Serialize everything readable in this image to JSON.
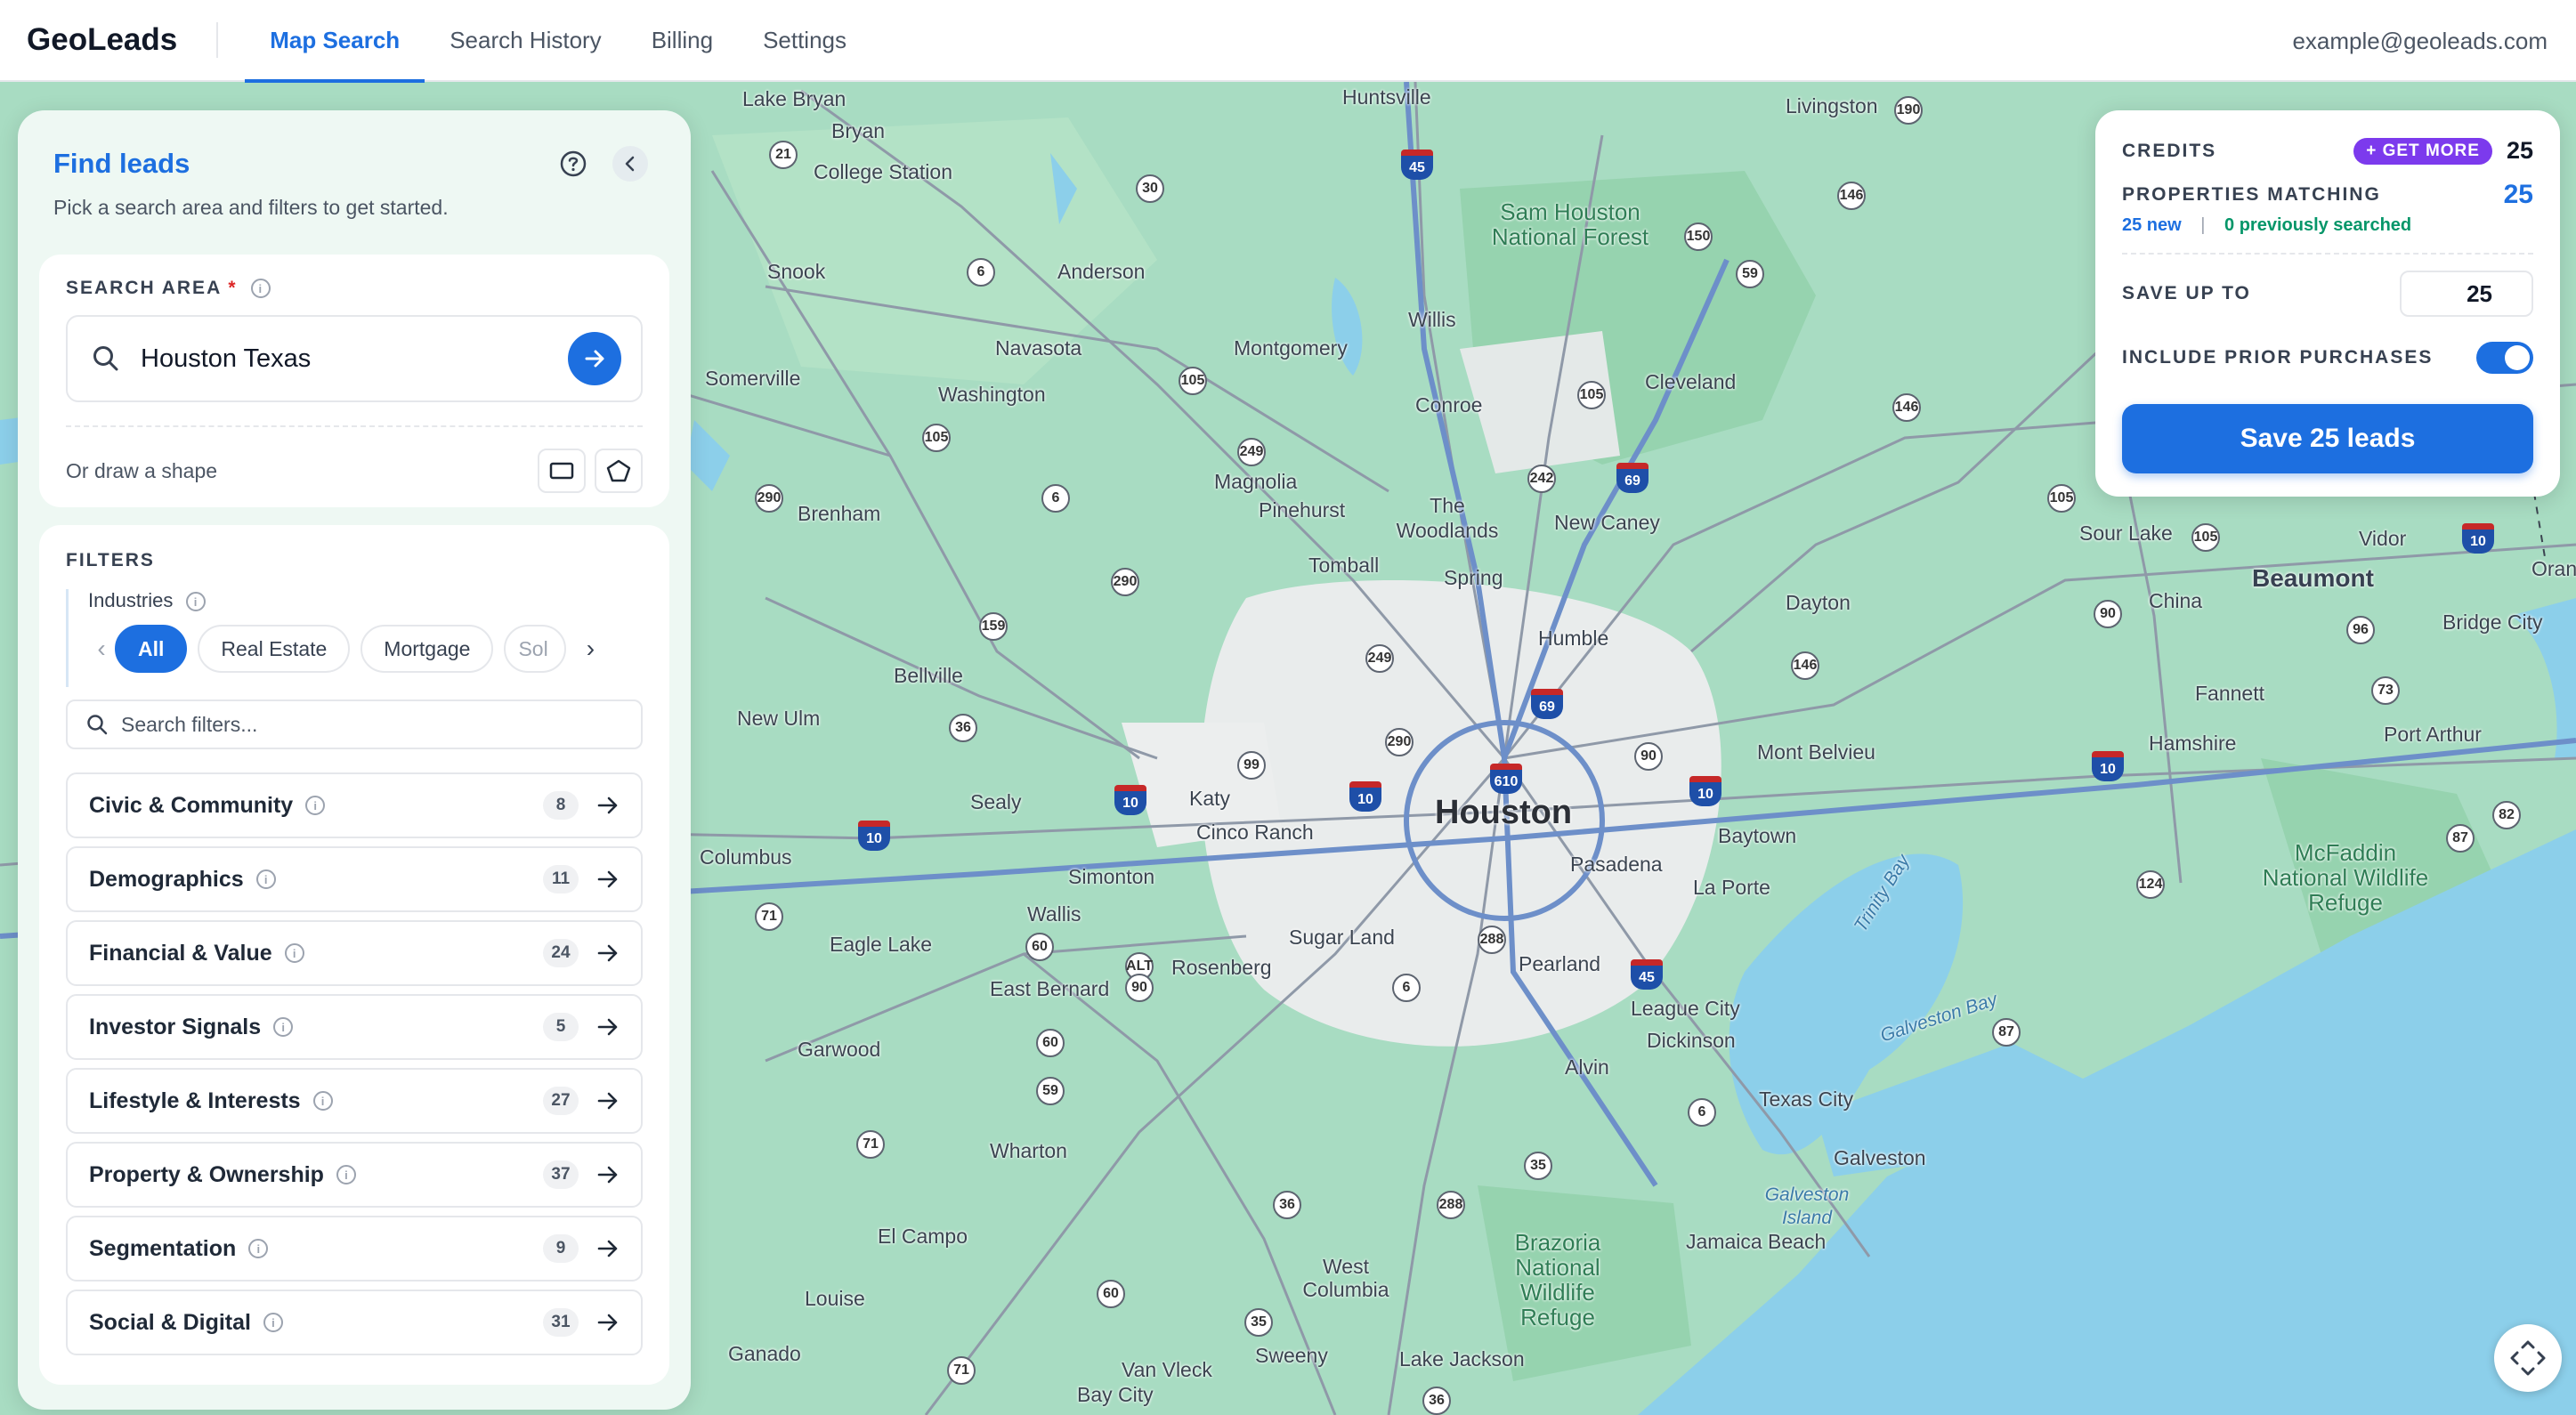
{
  "app": {
    "brand": "GeoLeads",
    "nav": [
      {
        "label": "Map Search",
        "active": true
      },
      {
        "label": "Search History",
        "active": false
      },
      {
        "label": "Billing",
        "active": false
      },
      {
        "label": "Settings",
        "active": false
      }
    ],
    "user_email": "example@geoleads.com"
  },
  "panel": {
    "title": "Find leads",
    "subtitle": "Pick a search area and filters to get started.",
    "search_area": {
      "label": "SEARCH AREA",
      "required_mark": "*",
      "value": "Houston Texas",
      "draw_label": "Or draw a shape"
    },
    "filters": {
      "label": "FILTERS",
      "industries_label": "Industries",
      "chips": [
        "All",
        "Real Estate",
        "Mortgage",
        "Sol"
      ],
      "search_placeholder": "Search filters...",
      "categories": [
        {
          "name": "Civic & Community",
          "count": "8"
        },
        {
          "name": "Demographics",
          "count": "11"
        },
        {
          "name": "Financial & Value",
          "count": "24"
        },
        {
          "name": "Investor Signals",
          "count": "5"
        },
        {
          "name": "Lifestyle & Interests",
          "count": "27"
        },
        {
          "name": "Property & Ownership",
          "count": "37"
        },
        {
          "name": "Segmentation",
          "count": "9"
        },
        {
          "name": "Social & Digital",
          "count": "31"
        }
      ]
    }
  },
  "credits": {
    "credits_label": "CREDITS",
    "get_more_label": "+ GET MORE",
    "credits_value": "25",
    "matching_label": "PROPERTIES MATCHING",
    "matching_value": "25",
    "new_text": "25 new",
    "sep": "|",
    "prev_text": "0 previously searched",
    "save_up_to_label": "SAVE UP TO",
    "save_up_to_value": "25",
    "include_prior_label": "INCLUDE PRIOR PURCHASES",
    "include_prior_on": true,
    "save_button": "Save 25 leads"
  },
  "map": {
    "places": [
      {
        "name": "Houston",
        "kind": "city"
      },
      {
        "name": "Beaumont",
        "kind": "big"
      },
      {
        "name": "Lake Bryan"
      },
      {
        "name": "Bryan"
      },
      {
        "name": "College Station"
      },
      {
        "name": "Huntsville"
      },
      {
        "name": "Livingston"
      },
      {
        "name": "Snook"
      },
      {
        "name": "Anderson"
      },
      {
        "name": "Navasota"
      },
      {
        "name": "Montgomery"
      },
      {
        "name": "Willis"
      },
      {
        "name": "Conroe"
      },
      {
        "name": "Cleveland"
      },
      {
        "name": "Somerville"
      },
      {
        "name": "Washington"
      },
      {
        "name": "Magnolia"
      },
      {
        "name": "Pinehurst"
      },
      {
        "name": "The Woodlands"
      },
      {
        "name": "New Caney"
      },
      {
        "name": "Brenham"
      },
      {
        "name": "Tomball"
      },
      {
        "name": "Spring"
      },
      {
        "name": "Humble"
      },
      {
        "name": "Dayton"
      },
      {
        "name": "Sour Lake"
      },
      {
        "name": "Vidor"
      },
      {
        "name": "China"
      },
      {
        "name": "Bridge City"
      },
      {
        "name": "Bellville"
      },
      {
        "name": "New Ulm"
      },
      {
        "name": "Sealy"
      },
      {
        "name": "Katy"
      },
      {
        "name": "Cinco Ranch"
      },
      {
        "name": "Mont Belvieu"
      },
      {
        "name": "Baytown"
      },
      {
        "name": "Fannett"
      },
      {
        "name": "Hamshire"
      },
      {
        "name": "Port Arthur"
      },
      {
        "name": "Columbus"
      },
      {
        "name": "Simonton"
      },
      {
        "name": "Pasadena"
      },
      {
        "name": "La Porte"
      },
      {
        "name": "Wallis"
      },
      {
        "name": "Eagle Lake"
      },
      {
        "name": "Sugar Land"
      },
      {
        "name": "Pearland"
      },
      {
        "name": "Rosenberg"
      },
      {
        "name": "East Bernard"
      },
      {
        "name": "League City"
      },
      {
        "name": "Dickinson"
      },
      {
        "name": "Garwood"
      },
      {
        "name": "Alvin"
      },
      {
        "name": "Texas City"
      },
      {
        "name": "Wharton"
      },
      {
        "name": "Galveston"
      },
      {
        "name": "El Campo"
      },
      {
        "name": "Jamaica Beach"
      },
      {
        "name": "West Columbia"
      },
      {
        "name": "Louise"
      },
      {
        "name": "Sweeny"
      },
      {
        "name": "Lake Jackson"
      },
      {
        "name": "Ganado"
      },
      {
        "name": "Van Vleck"
      },
      {
        "name": "Bay City"
      },
      {
        "name": "Oran"
      },
      {
        "name": "Sam Houston National Forest",
        "kind": "park"
      },
      {
        "name": "McFaddin National Wildlife Refuge",
        "kind": "park"
      },
      {
        "name": "Brazoria National Wildlife Refuge",
        "kind": "park"
      },
      {
        "name": "Trinity Bay",
        "kind": "water"
      },
      {
        "name": "Galveston Bay",
        "kind": "water"
      },
      {
        "name": "Galveston Island",
        "kind": "water"
      }
    ]
  }
}
